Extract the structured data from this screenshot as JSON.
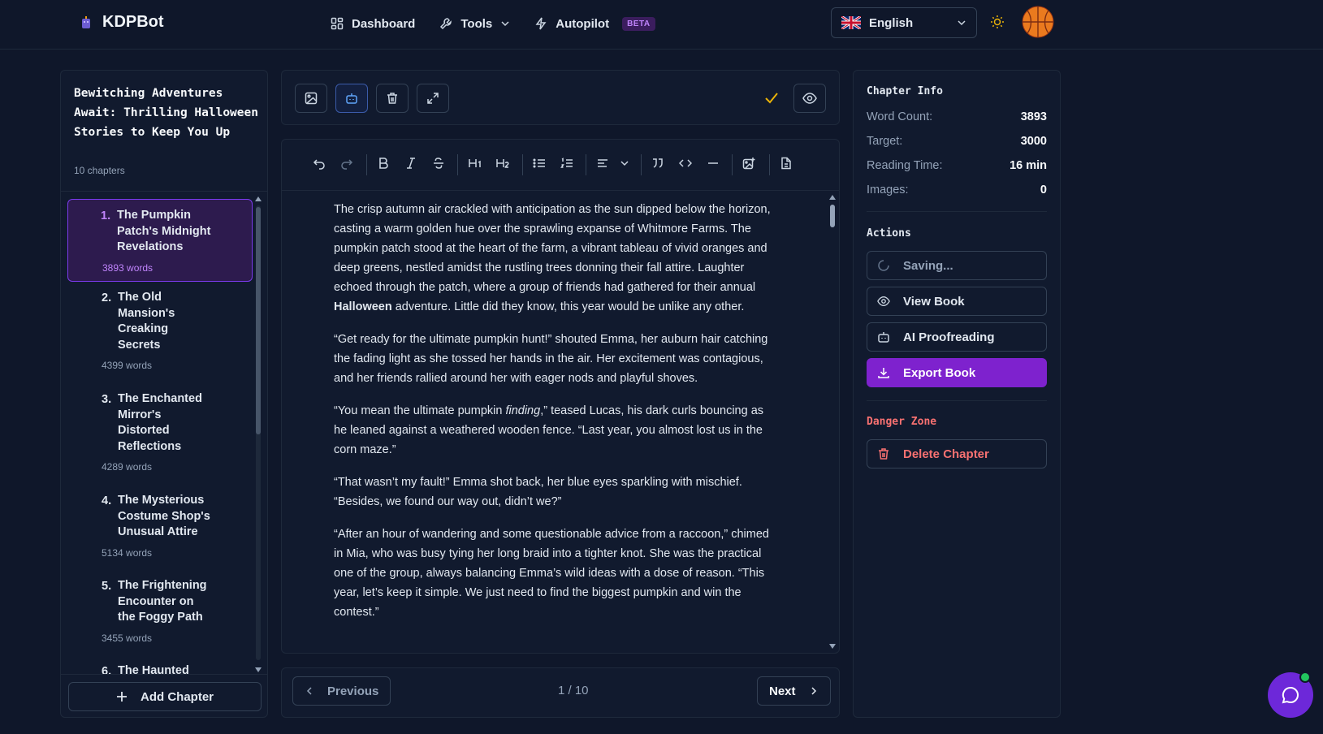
{
  "nav": {
    "brand": "KDPBot",
    "links": [
      {
        "label": "Dashboard"
      },
      {
        "label": "Tools"
      },
      {
        "label": "Autopilot",
        "badge": "BETA"
      }
    ],
    "language": "English"
  },
  "sidebar": {
    "book_title": "Bewitching Adventures Await: Thrilling Halloween Stories to Keep You Up",
    "chapter_count": "10 chapters",
    "chapters": [
      {
        "num": "1.",
        "title": "The Pumpkin Patch's Midnight Revelations",
        "words": "3893 words"
      },
      {
        "num": "2.",
        "title": "The Old Mansion's Creaking Secrets",
        "words": "4399 words"
      },
      {
        "num": "3.",
        "title": "The Enchanted Mirror's Distorted Reflections",
        "words": "4289 words"
      },
      {
        "num": "4.",
        "title": "The Mysterious Costume Shop's Unusual Attire",
        "words": "5134 words"
      },
      {
        "num": "5.",
        "title": "The Frightening Encounter on the Foggy Path",
        "words": "3455 words"
      },
      {
        "num": "6.",
        "title": "The Haunted",
        "words": ""
      }
    ],
    "add_chapter": "Add Chapter"
  },
  "editor": {
    "paragraphs": [
      {
        "before": "The crisp autumn air crackled with anticipation as the sun dipped below the horizon, casting a warm golden hue over the sprawling expanse of Whitmore Farms. The pumpkin patch stood at the heart of the farm, a vibrant tableau of vivid oranges and deep greens, nestled amidst the rustling trees donning their fall attire. Laughter echoed through the patch, where a group of friends had gathered for their annual ",
        "bold": "Halloween",
        "after": " adventure. Little did they know, this year would be unlike any other."
      },
      {
        "text": "“Get ready for the ultimate pumpkin hunt!” shouted Emma, her auburn hair catching the fading light as she tossed her hands in the air. Her excitement was contagious, and her friends rallied around her with eager nods and playful shoves."
      },
      {
        "before": "“You mean the ultimate pumpkin ",
        "italic": "finding",
        "after": ",” teased Lucas, his dark curls bouncing as he leaned against a weathered wooden fence. “Last year, you almost lost us in the corn maze.”"
      },
      {
        "text": "“That wasn’t my fault!” Emma shot back, her blue eyes sparkling with mischief. “Besides, we found our way out, didn’t we?”"
      },
      {
        "text": "“After an hour of wandering and some questionable advice from a raccoon,” chimed in Mia, who was busy tying her long braid into a tighter knot. She was the practical one of the group, always balancing Emma’s wild ideas with a dose of reason. “This year, let’s keep it simple. We just need to find the biggest pumpkin and win the contest.”"
      }
    ]
  },
  "pager": {
    "previous": "Previous",
    "next": "Next",
    "indicator": "1 / 10"
  },
  "info": {
    "heading": "Chapter Info",
    "stats": [
      {
        "label": "Word Count:",
        "value": "3893"
      },
      {
        "label": "Target:",
        "value": "3000"
      },
      {
        "label": "Reading Time:",
        "value": "16 min"
      },
      {
        "label": "Images:",
        "value": "0"
      }
    ],
    "actions_heading": "Actions",
    "actions": {
      "saving": "Saving...",
      "view": "View Book",
      "proof": "AI Proofreading",
      "export": "Export Book"
    },
    "danger_heading": "Danger Zone",
    "delete": "Delete Chapter"
  },
  "colors": {
    "accent": "#7e22ce",
    "danger": "#f87171",
    "check": "#eab308"
  }
}
